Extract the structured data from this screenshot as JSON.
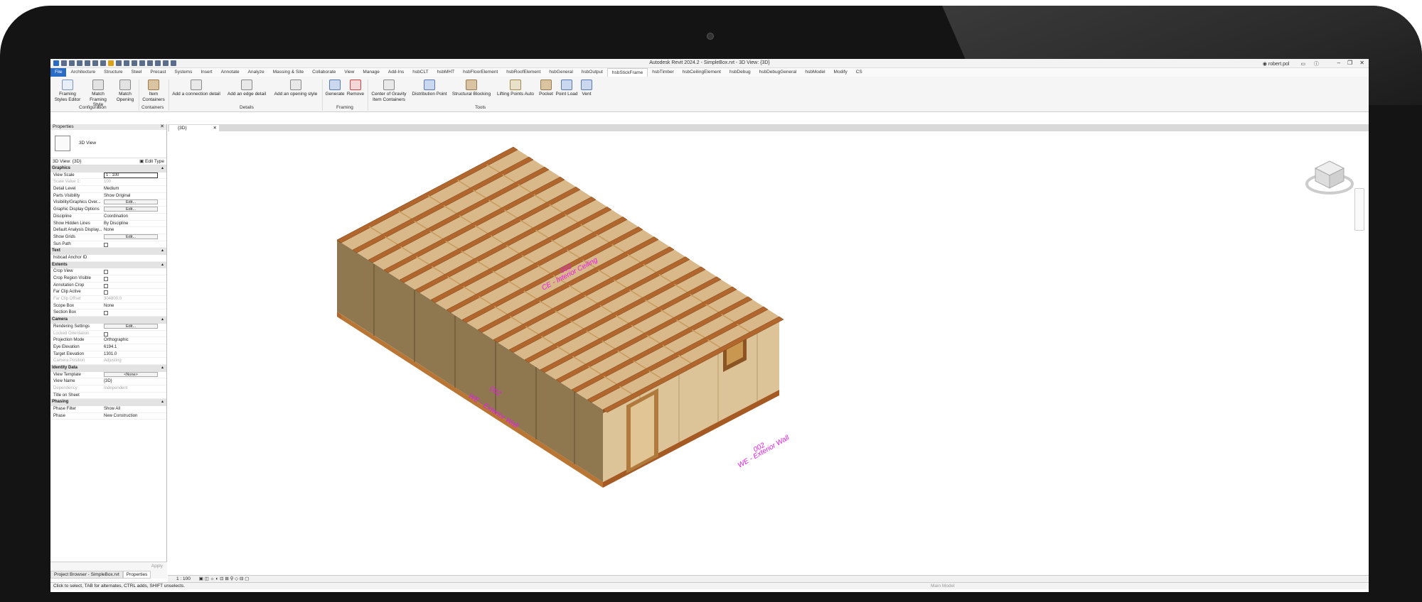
{
  "window": {
    "title": "Autodesk Revit 2024.2 - SimpleBox.rvt - 3D View: {3D}",
    "user": "robert.pol"
  },
  "tabs": [
    "File",
    "Architecture",
    "Structure",
    "Steel",
    "Precast",
    "Systems",
    "Insert",
    "Annotate",
    "Analyze",
    "Massing & Site",
    "Collaborate",
    "View",
    "Manage",
    "Add-Ins",
    "hsbCLT",
    "hsbMHT",
    "hsbFloorElement",
    "hsbRoofElement",
    "hsbGeneral",
    "hsbOutput",
    "hsbStickFrame",
    "hsbTimber",
    "hsbCeilingElement",
    "hsbDebug",
    "hsbDebugGeneral",
    "hsbModel",
    "Modify",
    "CS"
  ],
  "active_tab": "hsbStickFrame",
  "ribbon": {
    "framing_styles_editor": "Framing Styles Editor",
    "match_framing_style": "Match Framing Style",
    "match_opening": "Match Opening",
    "item_containers": "Item Containers",
    "add_connection": "Add a connection detail",
    "add_edge": "Add an edge detail",
    "add_opening": "Add an opening style",
    "generate": "Generate",
    "remove": "Remove",
    "center_gravity": "Center of Gravity Item Containers",
    "distribution_point": "Distribution Point",
    "structural_blocking": "Structural Blocking",
    "lifting_points": "Lifting Points Auto",
    "pocket": "Pocket",
    "point_load": "Point Load",
    "vent": "Vent",
    "panels": {
      "configuration": "Configuration",
      "containers": "Containers",
      "details": "Details",
      "framing": "Framing",
      "tools": "Tools"
    }
  },
  "properties": {
    "title": "Properties",
    "type_name": "3D View",
    "selector": "3D View: {3D}",
    "edit_type": "Edit Type",
    "groups": {
      "graphics": "Graphics",
      "text": "Text",
      "extents": "Extents",
      "camera": "Camera",
      "identity": "Identity Data",
      "phasing": "Phasing"
    },
    "rows": {
      "view_scale": [
        "View Scale",
        "1 : 100"
      ],
      "scale_value": [
        "Scale Value 1:",
        "100"
      ],
      "detail_level": [
        "Detail Level",
        "Medium"
      ],
      "parts_visibility": [
        "Parts Visibility",
        "Show Original"
      ],
      "vg_overrides": [
        "Visibility/Graphics Over...",
        "Edit..."
      ],
      "graphic_display": [
        "Graphic Display Options",
        "Edit..."
      ],
      "discipline": [
        "Discipline",
        "Coordination"
      ],
      "hidden_lines": [
        "Show Hidden Lines",
        "By Discipline"
      ],
      "analysis_display": [
        "Default Analysis Display...",
        "None"
      ],
      "show_grids": [
        "Show Grids",
        "Edit..."
      ],
      "sun_path": [
        "Sun Path",
        ""
      ],
      "anchor_id": [
        "hsbcad Anchor ID",
        ""
      ],
      "crop_view": [
        "Crop View",
        ""
      ],
      "crop_region": [
        "Crop Region Visible",
        ""
      ],
      "annotation_crop": [
        "Annotation Crop",
        ""
      ],
      "far_clip_active": [
        "Far Clip Active",
        ""
      ],
      "far_clip_offset": [
        "Far Clip Offset",
        "304800.0"
      ],
      "scope_box": [
        "Scope Box",
        "None"
      ],
      "section_box": [
        "Section Box",
        ""
      ],
      "rendering": [
        "Rendering Settings",
        "Edit..."
      ],
      "locked_orientation": [
        "Locked Orientation",
        ""
      ],
      "projection_mode": [
        "Projection Mode",
        "Orthographic"
      ],
      "eye_elevation": [
        "Eye Elevation",
        "6194.1"
      ],
      "target_elevation": [
        "Target Elevation",
        "1301.0"
      ],
      "camera_position": [
        "Camera Position",
        "Adjusting"
      ],
      "view_template": [
        "View Template",
        "<None>"
      ],
      "view_name": [
        "View Name",
        "{3D}"
      ],
      "dependency": [
        "Dependency",
        "Independent"
      ],
      "title_on_sheet": [
        "Title on Sheet",
        ""
      ],
      "phase_filter": [
        "Phase Filter",
        "Show All"
      ],
      "phase": [
        "Phase",
        "New Construction"
      ]
    },
    "apply": "Apply",
    "tab_browser": "Project Browser - SimpleBox.rvt",
    "tab_properties": "Properties"
  },
  "view": {
    "tab": "{3D}",
    "scale": "1 : 100",
    "labels": {
      "roof_num": "002",
      "roof_name": "CE - Interior Ceiling",
      "wall1_num": "002",
      "wall1_name": "WE - Exterior Wall",
      "wall2_num": "002",
      "wall2_name": "WE - Exterior Wall"
    }
  },
  "status": {
    "hint": "Click to select, TAB for alternates, CTRL adds, SHIFT unselects.",
    "model": "Main Model"
  },
  "colors": {
    "accent": "#2a6bc5",
    "annotation": "#e81ce6",
    "osb": "#c8a97a",
    "joist": "#b0662c"
  }
}
